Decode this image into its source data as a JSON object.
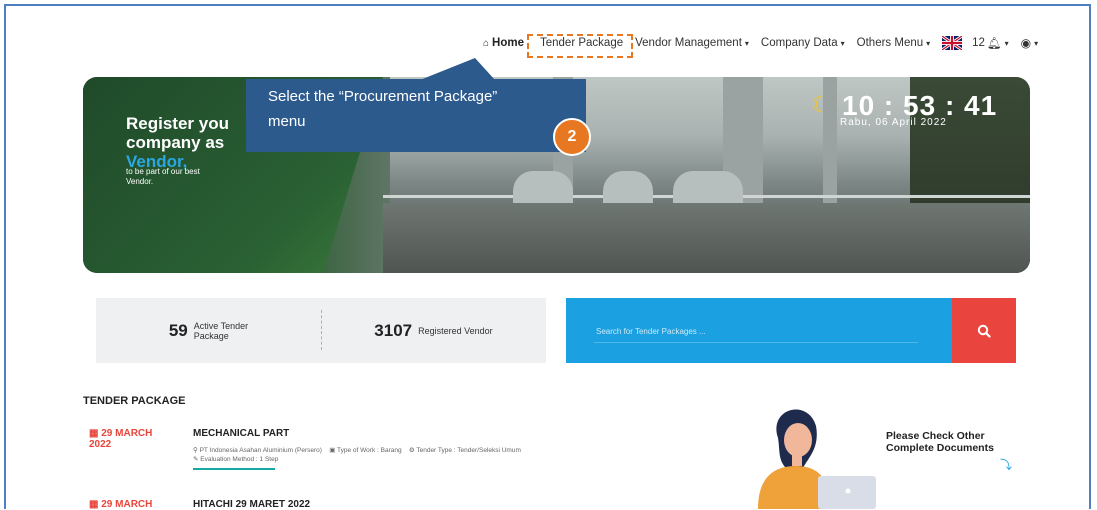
{
  "nav": {
    "home": "Home",
    "tender_package": "Tender Package",
    "vendor_management": "Vendor Management",
    "company_data": "Company Data",
    "others_menu": "Others Menu",
    "notifications": "12"
  },
  "hero": {
    "title_line1": "Register you",
    "title_line2": "company as",
    "title_line3": "Vendor,",
    "subtitle_line1": "to be part of our best",
    "subtitle_line2": "Vendor.",
    "clock": "10 : 53 : 41",
    "date": "Rabu, 06 April 2022"
  },
  "tooltip": {
    "line1": "Select the “Procurement  Package”",
    "line2": "menu",
    "step": "2"
  },
  "stats": {
    "active_num": "59",
    "active_label_1": "Active Tender",
    "active_label_2": "Package",
    "vendor_num": "3107",
    "vendor_label": "Registered Vendor"
  },
  "search": {
    "placeholder": "Search for Tender Packages ..."
  },
  "section_title": "TENDER PACKAGE",
  "tenders": [
    {
      "date_line1": "29 MARCH",
      "date_line2": "2022",
      "name": "MECHANICAL PART",
      "company": "PT Indonesia Asahan Aluminium (Persero)",
      "work_type": "Type of Work : Barang",
      "tender_type": "Tender Type : Tender/Seleksi Umum",
      "evaluation": "Evaluation Method : 1 Step"
    },
    {
      "date_line1": "29 MARCH",
      "name": "HITACHI 29 MARET 2022"
    }
  ],
  "check_docs": {
    "line1": "Please Check Other",
    "line2": "Complete Documents"
  }
}
